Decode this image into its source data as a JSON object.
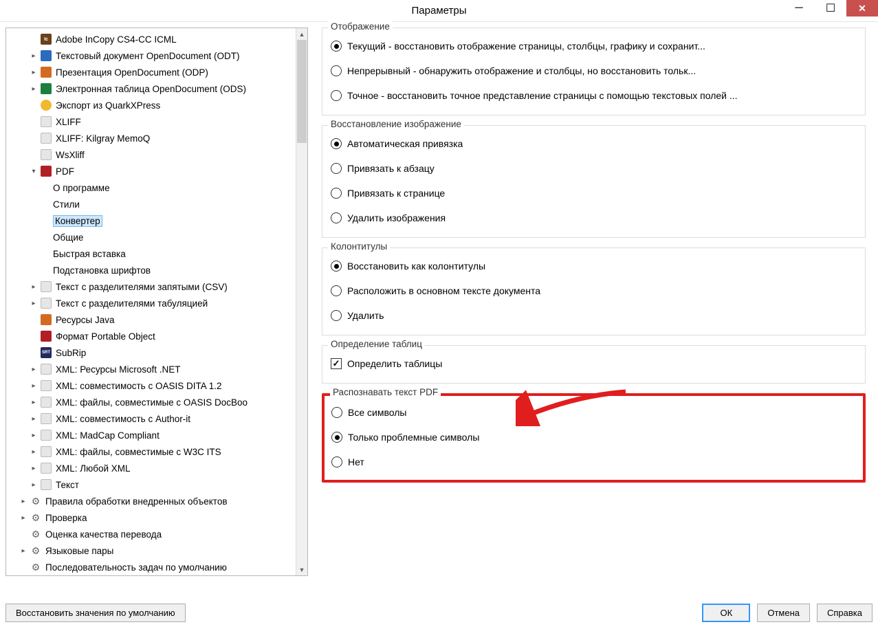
{
  "window": {
    "title": "Параметры"
  },
  "tree": [
    {
      "level": 2,
      "toggle": "none",
      "icon": "ic",
      "label": "Adobe InCopy CS4-CC ICML"
    },
    {
      "level": 2,
      "toggle": "closed",
      "icon": "doc",
      "label": "Текстовый документ OpenDocument (ODT)"
    },
    {
      "level": 2,
      "toggle": "closed",
      "icon": "odp",
      "label": "Презентация OpenDocument (ODP)"
    },
    {
      "level": 2,
      "toggle": "closed",
      "icon": "ods",
      "label": "Электронная таблица OpenDocument (ODS)"
    },
    {
      "level": 2,
      "toggle": "none",
      "icon": "quark",
      "label": "Экспорт из QuarkXPress"
    },
    {
      "level": 2,
      "toggle": "none",
      "icon": "xliff",
      "label": "XLIFF"
    },
    {
      "level": 2,
      "toggle": "none",
      "icon": "xliff",
      "label": "XLIFF: Kilgray MemoQ"
    },
    {
      "level": 2,
      "toggle": "none",
      "icon": "xliff",
      "label": "WsXliff"
    },
    {
      "level": 2,
      "toggle": "open",
      "icon": "pdf",
      "label": "PDF"
    },
    {
      "level": "sub",
      "toggle": "none",
      "icon": "",
      "label": "О программе"
    },
    {
      "level": "sub",
      "toggle": "none",
      "icon": "",
      "label": "Стили"
    },
    {
      "level": "sub",
      "toggle": "none",
      "icon": "",
      "label": "Конвертер",
      "selected": true
    },
    {
      "level": "sub",
      "toggle": "none",
      "icon": "",
      "label": "Общие"
    },
    {
      "level": "sub",
      "toggle": "none",
      "icon": "",
      "label": "Быстрая вставка"
    },
    {
      "level": "sub",
      "toggle": "none",
      "icon": "",
      "label": "Подстановка шрифтов"
    },
    {
      "level": 2,
      "toggle": "closed",
      "icon": "csv",
      "label": "Текст с разделителями запятыми (CSV)"
    },
    {
      "level": 2,
      "toggle": "closed",
      "icon": "tab",
      "label": "Текст с разделителями табуляцией"
    },
    {
      "level": 2,
      "toggle": "none",
      "icon": "java",
      "label": "Ресурсы Java"
    },
    {
      "level": 2,
      "toggle": "none",
      "icon": "po",
      "label": "Формат Portable Object"
    },
    {
      "level": 2,
      "toggle": "none",
      "icon": "subrip",
      "label": "SubRip"
    },
    {
      "level": 2,
      "toggle": "closed",
      "icon": "xml",
      "label": "XML: Ресурсы Microsoft .NET"
    },
    {
      "level": 2,
      "toggle": "closed",
      "icon": "xml",
      "label": "XML: совместимость с OASIS DITA 1.2"
    },
    {
      "level": 2,
      "toggle": "closed",
      "icon": "xml",
      "label": "XML: файлы, совместимые с OASIS DocBoo"
    },
    {
      "level": 2,
      "toggle": "closed",
      "icon": "xml",
      "label": "XML: совместимость с Author-it"
    },
    {
      "level": 2,
      "toggle": "closed",
      "icon": "xml",
      "label": "XML: MadCap Compliant"
    },
    {
      "level": 2,
      "toggle": "closed",
      "icon": "xml",
      "label": "XML: файлы, совместимые с W3C ITS"
    },
    {
      "level": 2,
      "toggle": "closed",
      "icon": "xml",
      "label": "XML: Любой XML"
    },
    {
      "level": 2,
      "toggle": "closed",
      "icon": "txt",
      "label": "Текст"
    },
    {
      "level": 1,
      "toggle": "closed",
      "icon": "gear",
      "label": "Правила обработки внедренных объектов"
    },
    {
      "level": 1,
      "toggle": "closed",
      "icon": "gear",
      "label": "Проверка"
    },
    {
      "level": 1,
      "toggle": "none",
      "icon": "gear",
      "label": "Оценка качества перевода"
    },
    {
      "level": 1,
      "toggle": "closed",
      "icon": "gear",
      "label": "Языковые пары"
    },
    {
      "level": 1,
      "toggle": "none",
      "icon": "gear",
      "label": "Последовательность задач по умолчанию"
    }
  ],
  "groups": {
    "display": {
      "title": "Отображение",
      "options": [
        {
          "label": "Текущий - восстановить отображение страницы, столбцы, графику и сохранит...",
          "checked": true
        },
        {
          "label": "Непрерывный - обнаружить отображение и столбцы, но восстановить тольк...",
          "checked": false
        },
        {
          "label": "Точное - восстановить точное представление страницы с помощью текстовых полей ...",
          "checked": false
        }
      ]
    },
    "image": {
      "title": "Восстановление изображение",
      "options": [
        {
          "label": "Автоматическая привязка",
          "checked": true
        },
        {
          "label": "Привязать к абзацу",
          "checked": false
        },
        {
          "label": "Привязать к странице",
          "checked": false
        },
        {
          "label": "Удалить изображения",
          "checked": false
        }
      ]
    },
    "headers": {
      "title": "Колонтитулы",
      "options": [
        {
          "label": "Восстановить как колонтитулы",
          "checked": true
        },
        {
          "label": "Расположить в основном тексте документа",
          "checked": false
        },
        {
          "label": "Удалить",
          "checked": false
        }
      ]
    },
    "tables": {
      "title": "Определение таблиц",
      "check_label": "Определить таблицы",
      "checked": true
    },
    "ocr": {
      "title": "Распознавать текст PDF",
      "options": [
        {
          "label": "Все символы",
          "checked": false
        },
        {
          "label": "Только проблемные символы",
          "checked": true
        },
        {
          "label": "Нет",
          "checked": false
        }
      ]
    }
  },
  "buttons": {
    "reset": "Восстановить значения по умолчанию",
    "ok": "ОК",
    "cancel": "Отмена",
    "help": "Справка"
  }
}
